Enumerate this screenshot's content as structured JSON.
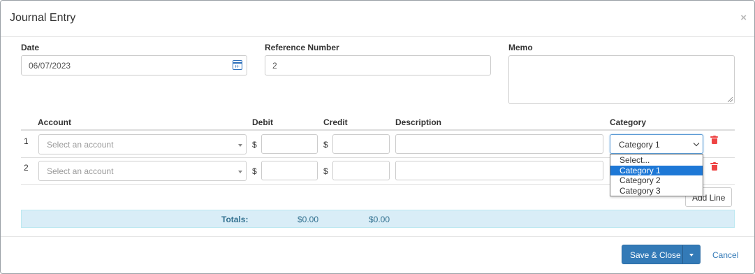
{
  "modal": {
    "title": "Journal Entry",
    "close_glyph": "×"
  },
  "fields": {
    "date_label": "Date",
    "date_value": "06/07/2023",
    "reference_label": "Reference Number",
    "reference_value": "2",
    "memo_label": "Memo",
    "memo_value": ""
  },
  "lines_table": {
    "headers": {
      "account": "Account",
      "debit": "Debit",
      "credit": "Credit",
      "description": "Description",
      "category": "Category"
    },
    "currency_symbol": "$",
    "rows": [
      {
        "number": "1",
        "account_placeholder": "Select an account",
        "debit": "",
        "credit": "",
        "description": "",
        "category": "Category 1"
      },
      {
        "number": "2",
        "account_placeholder": "Select an account",
        "debit": "",
        "credit": "",
        "description": "",
        "category": ""
      }
    ]
  },
  "category_dropdown": {
    "selected": "Category 1",
    "options": [
      "Select...",
      "Category 1",
      "Category 2",
      "Category 3"
    ]
  },
  "add_line_label": "Add Line",
  "totals": {
    "label": "Totals:",
    "debit": "$0.00",
    "credit": "$0.00"
  },
  "footer": {
    "save_label": "Save & Close",
    "cancel_label": "Cancel"
  },
  "colors": {
    "primary": "#337ab7",
    "totals_bg": "#d9edf7",
    "totals_text": "#31708f",
    "delete": "#ee4444",
    "dropdown_highlight": "#1e78d6"
  },
  "icons": {
    "date_picker": "calendar-icon",
    "delete_row": "trash-icon",
    "close": "close-icon"
  }
}
